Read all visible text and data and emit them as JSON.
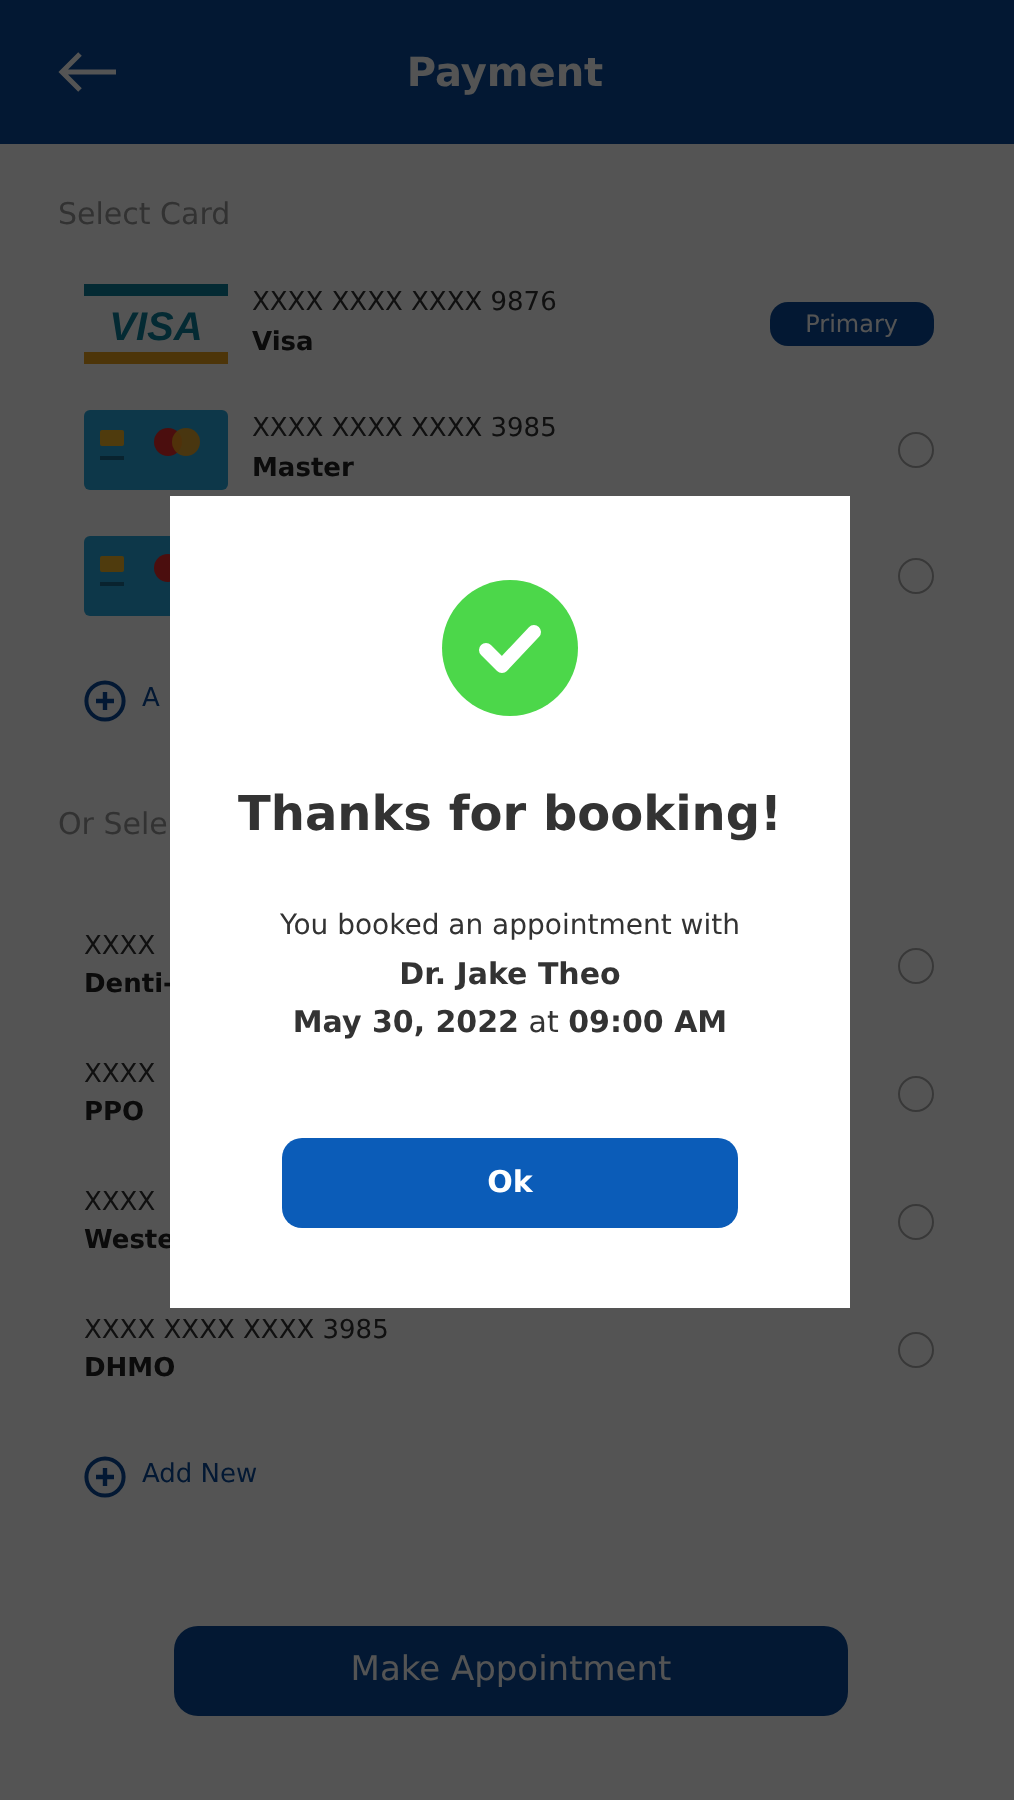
{
  "header": {
    "title": "Payment"
  },
  "cards": {
    "heading": "Select Card",
    "items": [
      {
        "kind": "visa",
        "logo": "VISA",
        "number": "XXXX XXXX XXXX 9876",
        "name": "Visa",
        "badge": "Primary"
      },
      {
        "kind": "master",
        "number": "XXXX XXXX XXXX 3985",
        "name": "Master",
        "selected": false
      },
      {
        "kind": "master",
        "selected": false
      }
    ],
    "add_new": "A"
  },
  "plans": {
    "heading": "Or Sele",
    "items": [
      {
        "number": "XXXX",
        "name": "Denti-",
        "selected": false
      },
      {
        "number": "XXXX",
        "name": "PPO",
        "selected": false
      },
      {
        "number": "XXXX",
        "name": "Weste",
        "selected": false
      },
      {
        "number": "XXXX XXXX XXXX 3985",
        "name": "DHMO",
        "selected": false
      }
    ],
    "add_new": "Add New"
  },
  "primary_button": "Make Appointment",
  "dialog": {
    "title": "Thanks for booking!",
    "lines": [
      "You booked an appointment with",
      "Dr. Jake Theo",
      "**May 30, 2022** at **09:00 AM**"
    ],
    "ok_button": "Ok"
  }
}
